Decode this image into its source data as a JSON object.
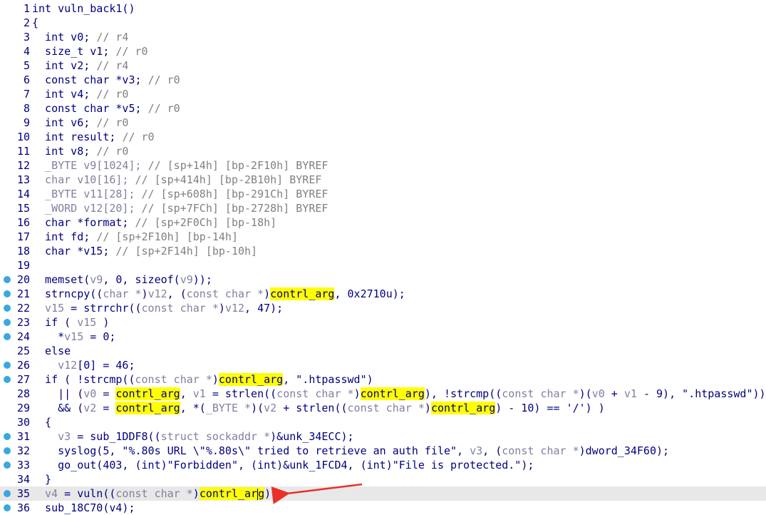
{
  "editor": {
    "lines": [
      {
        "n": "1",
        "bp": false,
        "segs": [
          [
            "pl",
            "int vuln_back1()"
          ]
        ]
      },
      {
        "n": "2",
        "bp": false,
        "segs": [
          [
            "pl",
            "{"
          ]
        ]
      },
      {
        "n": "3",
        "bp": false,
        "segs": [
          [
            "pl",
            "  int v0; "
          ],
          [
            "cm",
            "// r4"
          ]
        ]
      },
      {
        "n": "4",
        "bp": false,
        "segs": [
          [
            "pl",
            "  size_t v1; "
          ],
          [
            "cm",
            "// r0"
          ]
        ]
      },
      {
        "n": "5",
        "bp": false,
        "segs": [
          [
            "pl",
            "  int v2; "
          ],
          [
            "cm",
            "// r4"
          ]
        ]
      },
      {
        "n": "6",
        "bp": false,
        "segs": [
          [
            "pl",
            "  const char *v3; "
          ],
          [
            "cm",
            "// r0"
          ]
        ]
      },
      {
        "n": "7",
        "bp": false,
        "segs": [
          [
            "pl",
            "  int v4; "
          ],
          [
            "cm",
            "// r0"
          ]
        ]
      },
      {
        "n": "8",
        "bp": false,
        "segs": [
          [
            "pl",
            "  const char *v5; "
          ],
          [
            "cm",
            "// r0"
          ]
        ]
      },
      {
        "n": "9",
        "bp": false,
        "segs": [
          [
            "pl",
            "  int v6; "
          ],
          [
            "cm",
            "// r0"
          ]
        ]
      },
      {
        "n": "10",
        "bp": false,
        "segs": [
          [
            "pl",
            "  int result; "
          ],
          [
            "cm",
            "// r0"
          ]
        ]
      },
      {
        "n": "11",
        "bp": false,
        "segs": [
          [
            "pl",
            "  int v8; "
          ],
          [
            "cm",
            "// r0"
          ]
        ]
      },
      {
        "n": "12",
        "bp": false,
        "segs": [
          [
            "var",
            "  _BYTE v9[1024]; "
          ],
          [
            "cm",
            "// [sp+14h] [bp-2F10h] BYREF"
          ]
        ]
      },
      {
        "n": "13",
        "bp": false,
        "segs": [
          [
            "var",
            "  char v10[16]; "
          ],
          [
            "cm",
            "// [sp+414h] [bp-2B10h] BYREF"
          ]
        ]
      },
      {
        "n": "14",
        "bp": false,
        "segs": [
          [
            "var",
            "  _BYTE v11[28]; "
          ],
          [
            "cm",
            "// [sp+608h] [bp-291Ch] BYREF"
          ]
        ]
      },
      {
        "n": "15",
        "bp": false,
        "segs": [
          [
            "var",
            "  _WORD v12[20]; "
          ],
          [
            "cm",
            "// [sp+7FCh] [bp-2728h] BYREF"
          ]
        ]
      },
      {
        "n": "16",
        "bp": false,
        "segs": [
          [
            "pl",
            "  char *format; "
          ],
          [
            "cm",
            "// [sp+2F0Ch] [bp-18h]"
          ]
        ]
      },
      {
        "n": "17",
        "bp": false,
        "segs": [
          [
            "pl",
            "  int fd; "
          ],
          [
            "cm",
            "// [sp+2F10h] [bp-14h]"
          ]
        ]
      },
      {
        "n": "18",
        "bp": false,
        "segs": [
          [
            "pl",
            "  char *v15; "
          ],
          [
            "cm",
            "// [sp+2F14h] [bp-10h]"
          ]
        ]
      },
      {
        "n": "19",
        "bp": false,
        "segs": [
          [
            "pl",
            ""
          ]
        ]
      },
      {
        "n": "20",
        "bp": true,
        "segs": [
          [
            "pl",
            "  memset("
          ],
          [
            "var",
            "v9"
          ],
          [
            "pl",
            ", 0, sizeof("
          ],
          [
            "var",
            "v9"
          ],
          [
            "pl",
            "));"
          ]
        ]
      },
      {
        "n": "21",
        "bp": true,
        "segs": [
          [
            "pl",
            "  strncpy(("
          ],
          [
            "ty",
            "char *"
          ],
          [
            "pl",
            ")"
          ],
          [
            "var",
            "v12"
          ],
          [
            "pl",
            ", ("
          ],
          [
            "ty",
            "const char *"
          ],
          [
            "pl",
            ")"
          ],
          [
            "hl",
            "contrl_arg"
          ],
          [
            "pl",
            ", 0x2710u);"
          ]
        ]
      },
      {
        "n": "22",
        "bp": true,
        "segs": [
          [
            "var",
            "  v15"
          ],
          [
            "pl",
            " = strrchr(("
          ],
          [
            "ty",
            "const char *"
          ],
          [
            "pl",
            ")"
          ],
          [
            "var",
            "v12"
          ],
          [
            "pl",
            ", 47);"
          ]
        ]
      },
      {
        "n": "23",
        "bp": true,
        "segs": [
          [
            "pl",
            "  if ( "
          ],
          [
            "var",
            "v15"
          ],
          [
            "pl",
            " )"
          ]
        ]
      },
      {
        "n": "24",
        "bp": true,
        "segs": [
          [
            "pl",
            "    *"
          ],
          [
            "var",
            "v15"
          ],
          [
            "pl",
            " = 0;"
          ]
        ]
      },
      {
        "n": "25",
        "bp": false,
        "segs": [
          [
            "pl",
            "  else"
          ]
        ]
      },
      {
        "n": "26",
        "bp": true,
        "segs": [
          [
            "var",
            "    v12"
          ],
          [
            "pl",
            "[0] = 46;"
          ]
        ]
      },
      {
        "n": "27",
        "bp": true,
        "segs": [
          [
            "pl",
            "  if ( !strcmp(("
          ],
          [
            "ty",
            "const char *"
          ],
          [
            "pl",
            ")"
          ],
          [
            "hl",
            "contrl_arg"
          ],
          [
            "pl",
            ", \".htpasswd\")"
          ]
        ]
      },
      {
        "n": "28",
        "bp": false,
        "segs": [
          [
            "pl",
            "    || ("
          ],
          [
            "var",
            "v0"
          ],
          [
            "pl",
            " = "
          ],
          [
            "hl",
            "contrl_arg"
          ],
          [
            "pl",
            ", "
          ],
          [
            "var",
            "v1"
          ],
          [
            "pl",
            " = strlen(("
          ],
          [
            "ty",
            "const char *"
          ],
          [
            "pl",
            ")"
          ],
          [
            "hl",
            "contrl_arg"
          ],
          [
            "pl",
            "), !strcmp(("
          ],
          [
            "ty",
            "const char *"
          ],
          [
            "pl",
            ")("
          ],
          [
            "var",
            "v0"
          ],
          [
            "pl",
            " + "
          ],
          [
            "var",
            "v1"
          ],
          [
            "pl",
            " - 9), \".htpasswd\"))"
          ]
        ]
      },
      {
        "n": "29",
        "bp": false,
        "segs": [
          [
            "pl",
            "    && ("
          ],
          [
            "var",
            "v2"
          ],
          [
            "pl",
            " = "
          ],
          [
            "hl",
            "contrl_arg"
          ],
          [
            "pl",
            ", *("
          ],
          [
            "ty",
            "_BYTE *"
          ],
          [
            "pl",
            ")("
          ],
          [
            "var",
            "v2"
          ],
          [
            "pl",
            " + strlen(("
          ],
          [
            "ty",
            "const char *"
          ],
          [
            "pl",
            ")"
          ],
          [
            "hl",
            "contrl_arg"
          ],
          [
            "pl",
            ") - 10) == '/') )"
          ]
        ]
      },
      {
        "n": "30",
        "bp": false,
        "segs": [
          [
            "pl",
            "  {"
          ]
        ]
      },
      {
        "n": "31",
        "bp": true,
        "segs": [
          [
            "var",
            "    v3"
          ],
          [
            "pl",
            " = sub_1DDF8(("
          ],
          [
            "ty",
            "struct sockaddr *"
          ],
          [
            "pl",
            ")&unk_34ECC);"
          ]
        ]
      },
      {
        "n": "32",
        "bp": true,
        "segs": [
          [
            "pl",
            "    syslog(5, \"%.80s URL \\\"%.80s\\\" tried to retrieve an auth file\", "
          ],
          [
            "var",
            "v3"
          ],
          [
            "pl",
            ", ("
          ],
          [
            "ty",
            "const char *"
          ],
          [
            "pl",
            ")dword_34F60);"
          ]
        ]
      },
      {
        "n": "33",
        "bp": true,
        "segs": [
          [
            "pl",
            "    go_out(403, (int)\"Forbidden\", (int)&unk_1FCD4, (int)\"File is protected.\");"
          ]
        ]
      },
      {
        "n": "34",
        "bp": false,
        "segs": [
          [
            "pl",
            "  }"
          ]
        ]
      },
      {
        "n": "35",
        "bp": true,
        "current": true,
        "segs": [
          [
            "var",
            "  v4"
          ],
          [
            "pl",
            " = vuln(("
          ],
          [
            "ty",
            "const char *"
          ],
          [
            "pl",
            ")"
          ],
          [
            "hl",
            "contrl_ar"
          ],
          [
            "cursor",
            ""
          ],
          [
            "hl",
            "g"
          ],
          [
            "pl",
            ");"
          ]
        ]
      },
      {
        "n": "36",
        "bp": true,
        "segs": [
          [
            "pl",
            "  sub_18C70(v4);"
          ]
        ]
      }
    ]
  },
  "annotation": {
    "arrow_color": "#e8312a",
    "points_to_line": "35"
  },
  "colors": {
    "plain": "#000080",
    "comment": "#808080",
    "variable": "#8080a0",
    "highlight": "#ffff00",
    "breakpoint": "#3aa7e0"
  }
}
